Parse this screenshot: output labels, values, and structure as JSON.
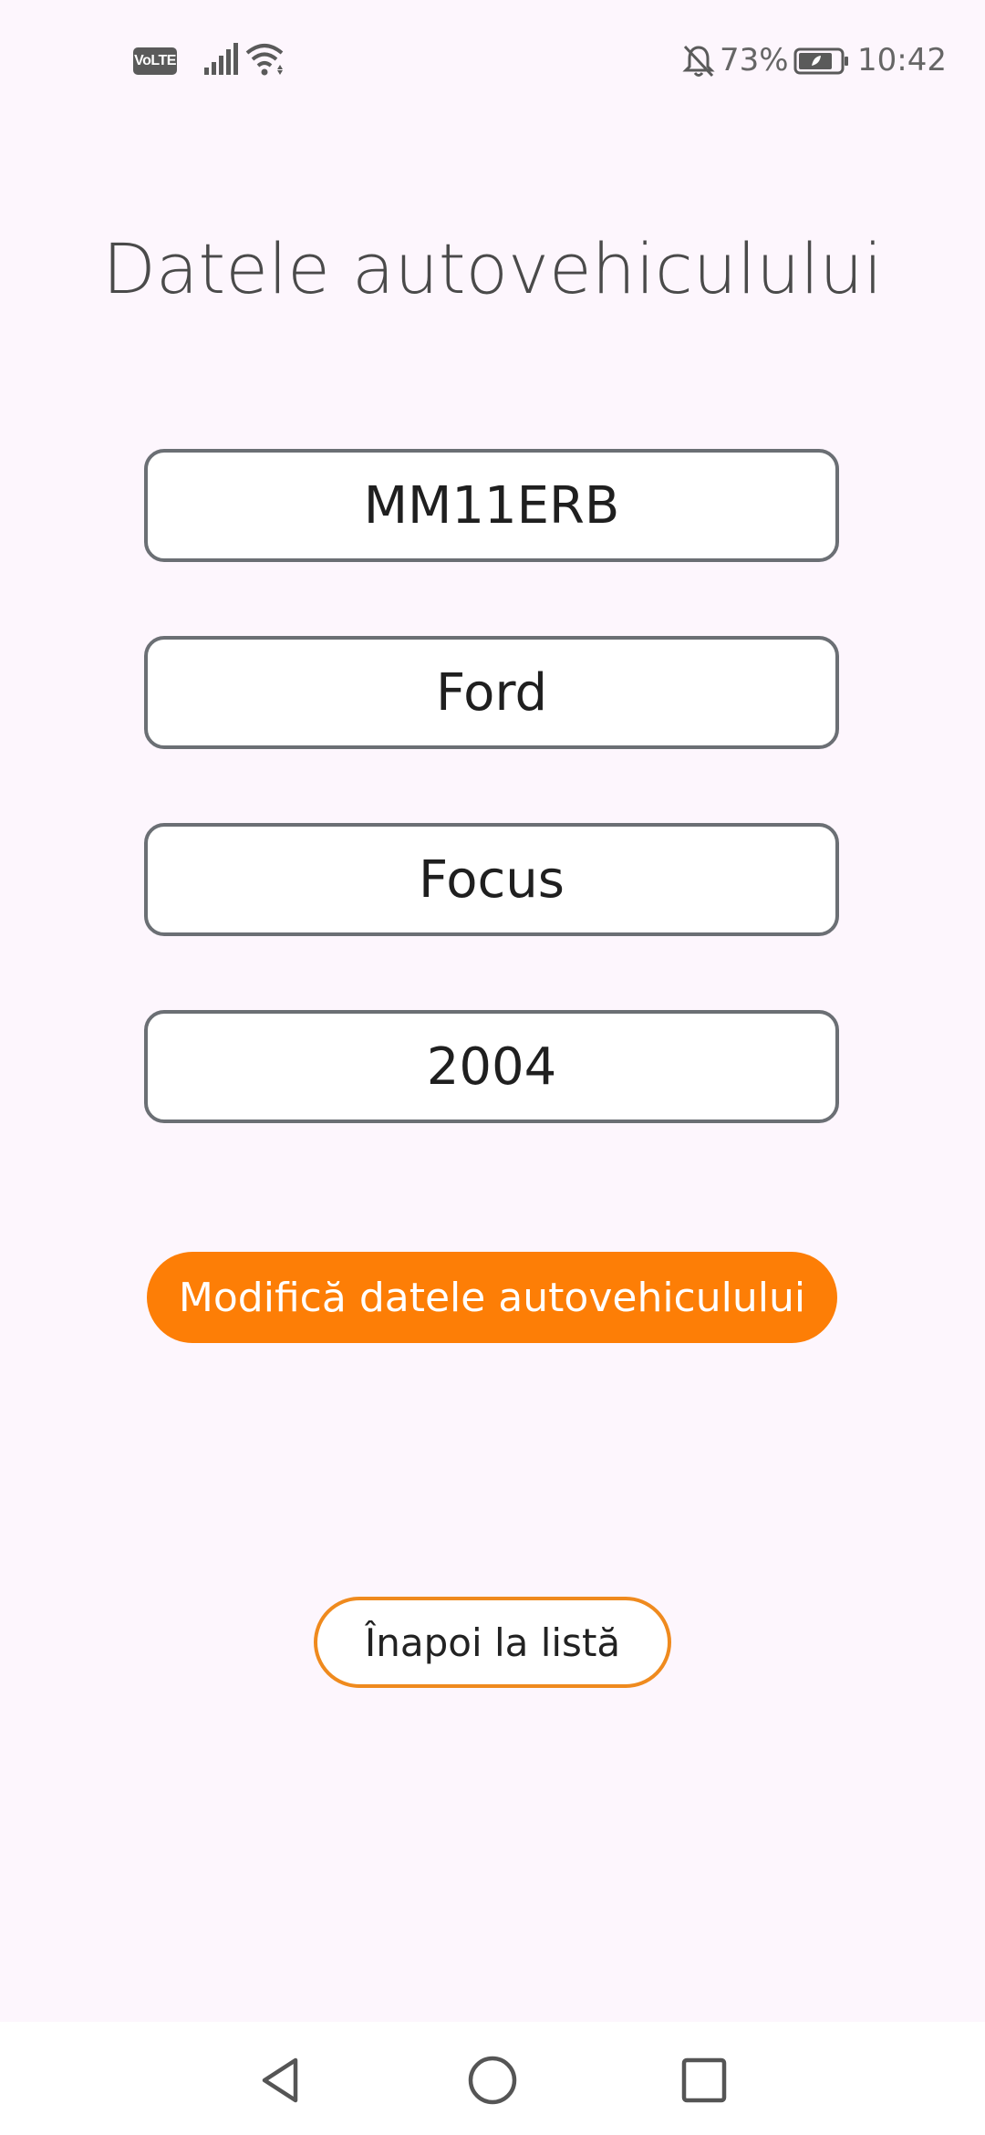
{
  "status_bar": {
    "volte_label": "VoLTE",
    "battery_percent": "73%",
    "time": "10:42",
    "icons": [
      "volte-icon",
      "signal-icon",
      "wifi-icon",
      "bell-muted-icon",
      "battery-icon"
    ]
  },
  "page": {
    "title": "Datele autovehiculului"
  },
  "fields": {
    "plate": "MM11ERB",
    "make": "Ford",
    "model": "Focus",
    "year": "2004"
  },
  "actions": {
    "modify_label": "Modifică datele autovehiculului",
    "back_label": "Înapoi la listă"
  },
  "nav_bar": {
    "icons": [
      "back-triangle-icon",
      "home-circle-icon",
      "recents-square-icon"
    ]
  },
  "colors": {
    "background": "#fdf6fd",
    "primary_button": "#fd7e06",
    "secondary_border": "#ef8a1e",
    "field_border": "#6b6f74"
  }
}
